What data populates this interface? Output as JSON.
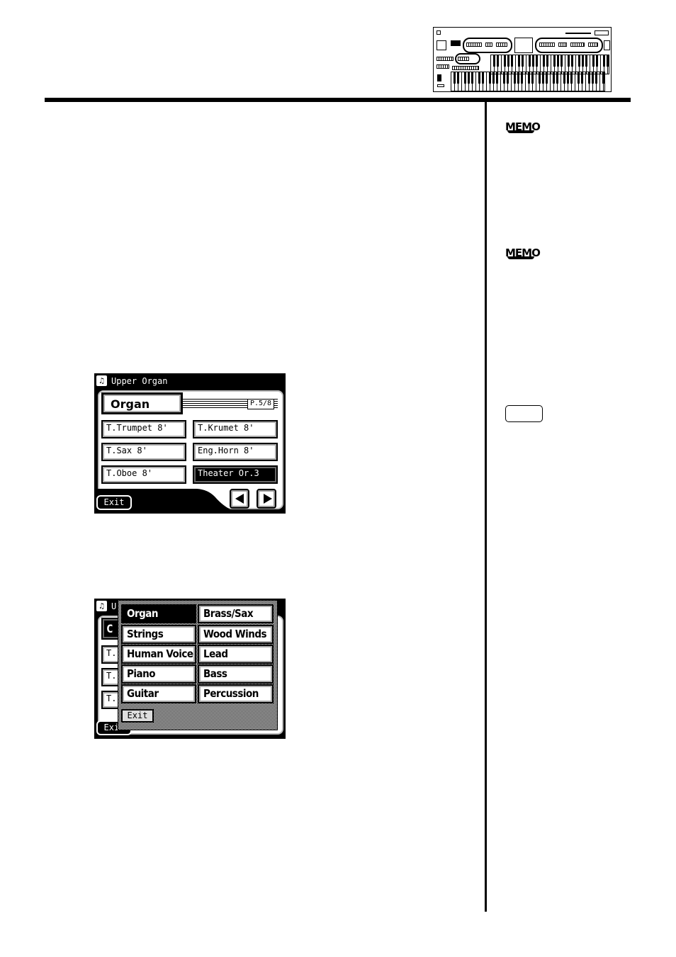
{
  "header": {
    "illustration": "organ-keyboard-panel-illustration"
  },
  "sidebar": {
    "memo_icons": [
      {
        "label": "MEMO"
      },
      {
        "label": "MEMO"
      }
    ],
    "note_box": {
      "label": ""
    }
  },
  "screen1": {
    "title": "Upper Organ",
    "title_icon": "music-note-icon",
    "category": "Organ",
    "page_indicator": "P.5/8",
    "voices": [
      {
        "label": "T.Trumpet  8'",
        "selected": false
      },
      {
        "label": "T.Krumet  8'",
        "selected": false
      },
      {
        "label": "T.Sax  8'",
        "selected": false
      },
      {
        "label": "Eng.Horn  8'",
        "selected": false
      },
      {
        "label": "T.Oboe  8'",
        "selected": false
      },
      {
        "label": "Theater Or.3",
        "selected": true
      }
    ],
    "exit_label": "Exit",
    "prev_icon": "left-arrow-icon",
    "next_icon": "right-arrow-icon"
  },
  "screen2": {
    "title_partial": "U",
    "categories": [
      {
        "label": "Organ",
        "selected": true
      },
      {
        "label": "Brass/Sax",
        "selected": false
      },
      {
        "label": "Strings",
        "selected": false
      },
      {
        "label": "Wood Winds",
        "selected": false
      },
      {
        "label": "Human Voice",
        "selected": false
      },
      {
        "label": "Lead",
        "selected": false
      },
      {
        "label": "Piano",
        "selected": false
      },
      {
        "label": "Bass",
        "selected": false
      },
      {
        "label": "Guitar",
        "selected": false
      },
      {
        "label": "Percussion",
        "selected": false
      }
    ],
    "exit_label": "Exit",
    "bg_exit_label": "Exit",
    "bg_fragments": [
      "C",
      "T.",
      "T.",
      "T."
    ]
  }
}
